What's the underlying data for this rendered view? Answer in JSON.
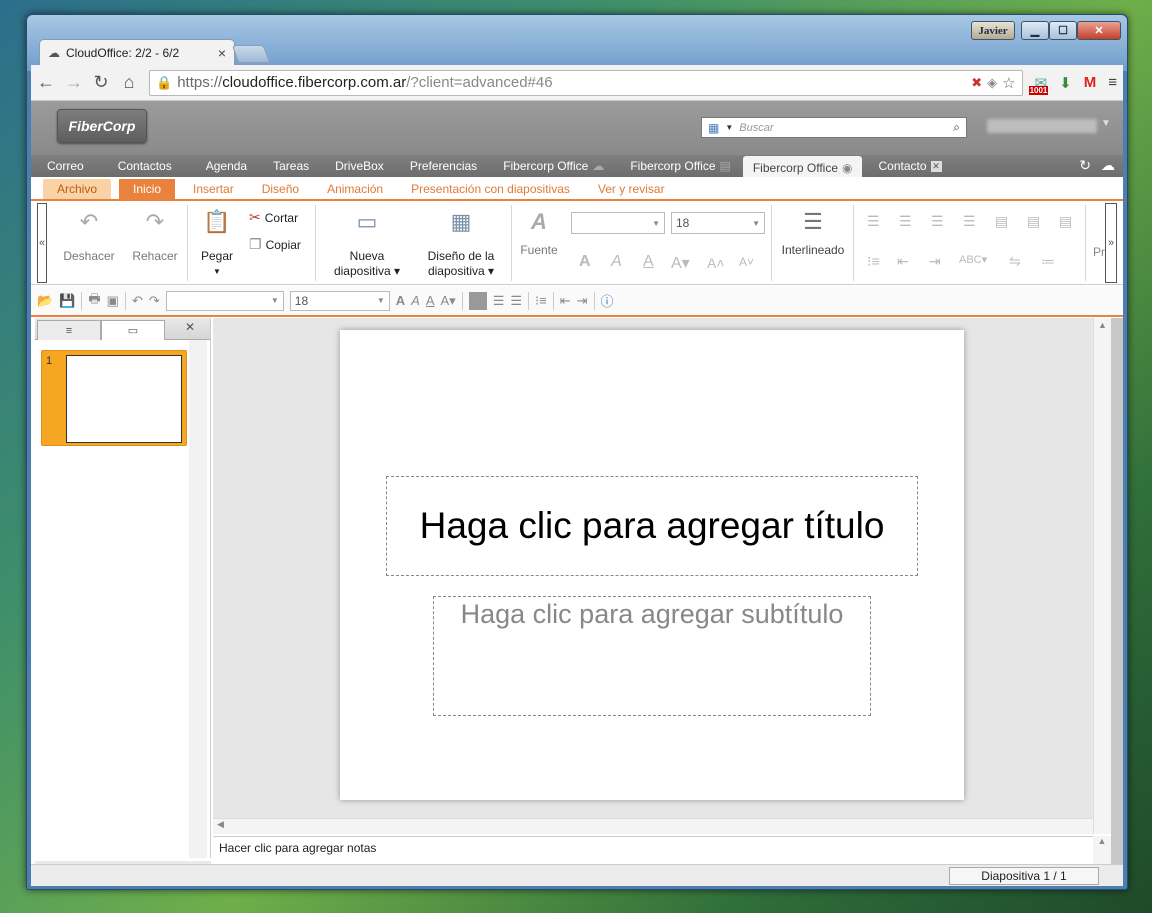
{
  "window": {
    "user_button": "Javier",
    "min_label": "▁",
    "max_label": "☐",
    "close_label": "✕"
  },
  "browser": {
    "tab_title": "CloudOffice: 2/2 - 6/2",
    "tab_close": "×",
    "url_https": "https://",
    "url_host": "cloudoffice.fibercorp.com.ar",
    "url_path": "/?client=advanced#46",
    "ext_badge": "1001"
  },
  "app": {
    "logo": "FiberCorp",
    "search_placeholder": "Buscar",
    "main_nav": [
      "Correo",
      "Contactos",
      "Agenda",
      "Tareas",
      "DriveBox",
      "Preferencias",
      "Fibercorp Office",
      "Fibercorp Office",
      "Fibercorp Office",
      "Contacto"
    ],
    "ribbon_tabs": [
      "Archivo",
      "Inicio",
      "Insertar",
      "Diseño",
      "Animación",
      "Presentación con diapositivas",
      "Ver y revisar"
    ],
    "ribbon": {
      "undo": "Deshacer",
      "redo": "Rehacer",
      "paste": "Pegar",
      "cut": "Cortar",
      "copy": "Copiar",
      "new_slide_1": "Nueva",
      "new_slide_2": "diapositiva",
      "layout_1": "Diseño de la",
      "layout_2": "diapositiva",
      "font": "Fuente",
      "font_size": "18",
      "line_spacing": "Interlineado",
      "more": "Pr"
    },
    "quick_font_size": "18",
    "thumb_number": "1",
    "slide": {
      "title_placeholder": "Haga clic para agregar título",
      "subtitle_placeholder": "Haga clic para agregar subtítulo"
    },
    "notes_placeholder": "Hacer clic para agregar notas",
    "status": "Diapositiva 1 / 1"
  }
}
